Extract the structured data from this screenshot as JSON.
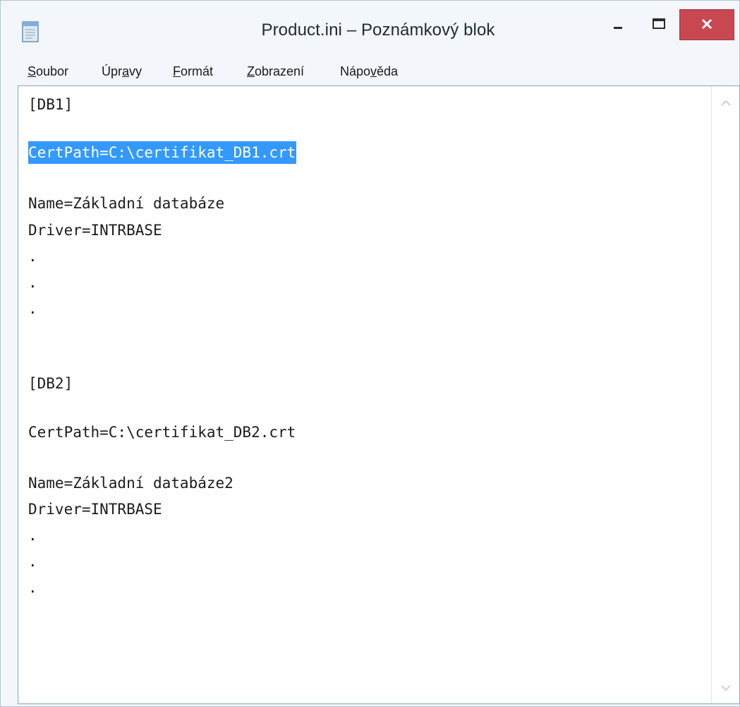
{
  "window": {
    "title": "Product.ini – Poznámkový blok",
    "controls": {
      "minimize_icon": "minimize-icon",
      "maximize_icon": "maximize-icon",
      "close_icon": "close-icon"
    },
    "close_button_color": "#c74850"
  },
  "menu": {
    "items": [
      {
        "pre": "",
        "mnemonic": "S",
        "post": "oubor"
      },
      {
        "pre": "Úpr",
        "mnemonic": "a",
        "post": "vy"
      },
      {
        "pre": "",
        "mnemonic": "F",
        "post": "ormát"
      },
      {
        "pre": "",
        "mnemonic": "Z",
        "post": "obrazení"
      },
      {
        "pre": "Nápo",
        "mnemonic": "v",
        "post": "ěda"
      }
    ]
  },
  "editor": {
    "selection_color": "#3399ff",
    "lines": [
      "[DB1]",
      "",
      "CertPath=C:\\certifikat_DB1.crt",
      "",
      "Name=Základní databáze",
      "Driver=INTRBASE",
      ".",
      ".",
      ".",
      "",
      "",
      "[DB2]",
      "",
      "CertPath=C:\\certifikat_DB2.crt",
      "",
      "Name=Základní databáze2",
      "Driver=INTRBASE",
      ".",
      ".",
      "."
    ],
    "selected_line": "CertPath=C:\\certifikat_DB1.crt"
  }
}
